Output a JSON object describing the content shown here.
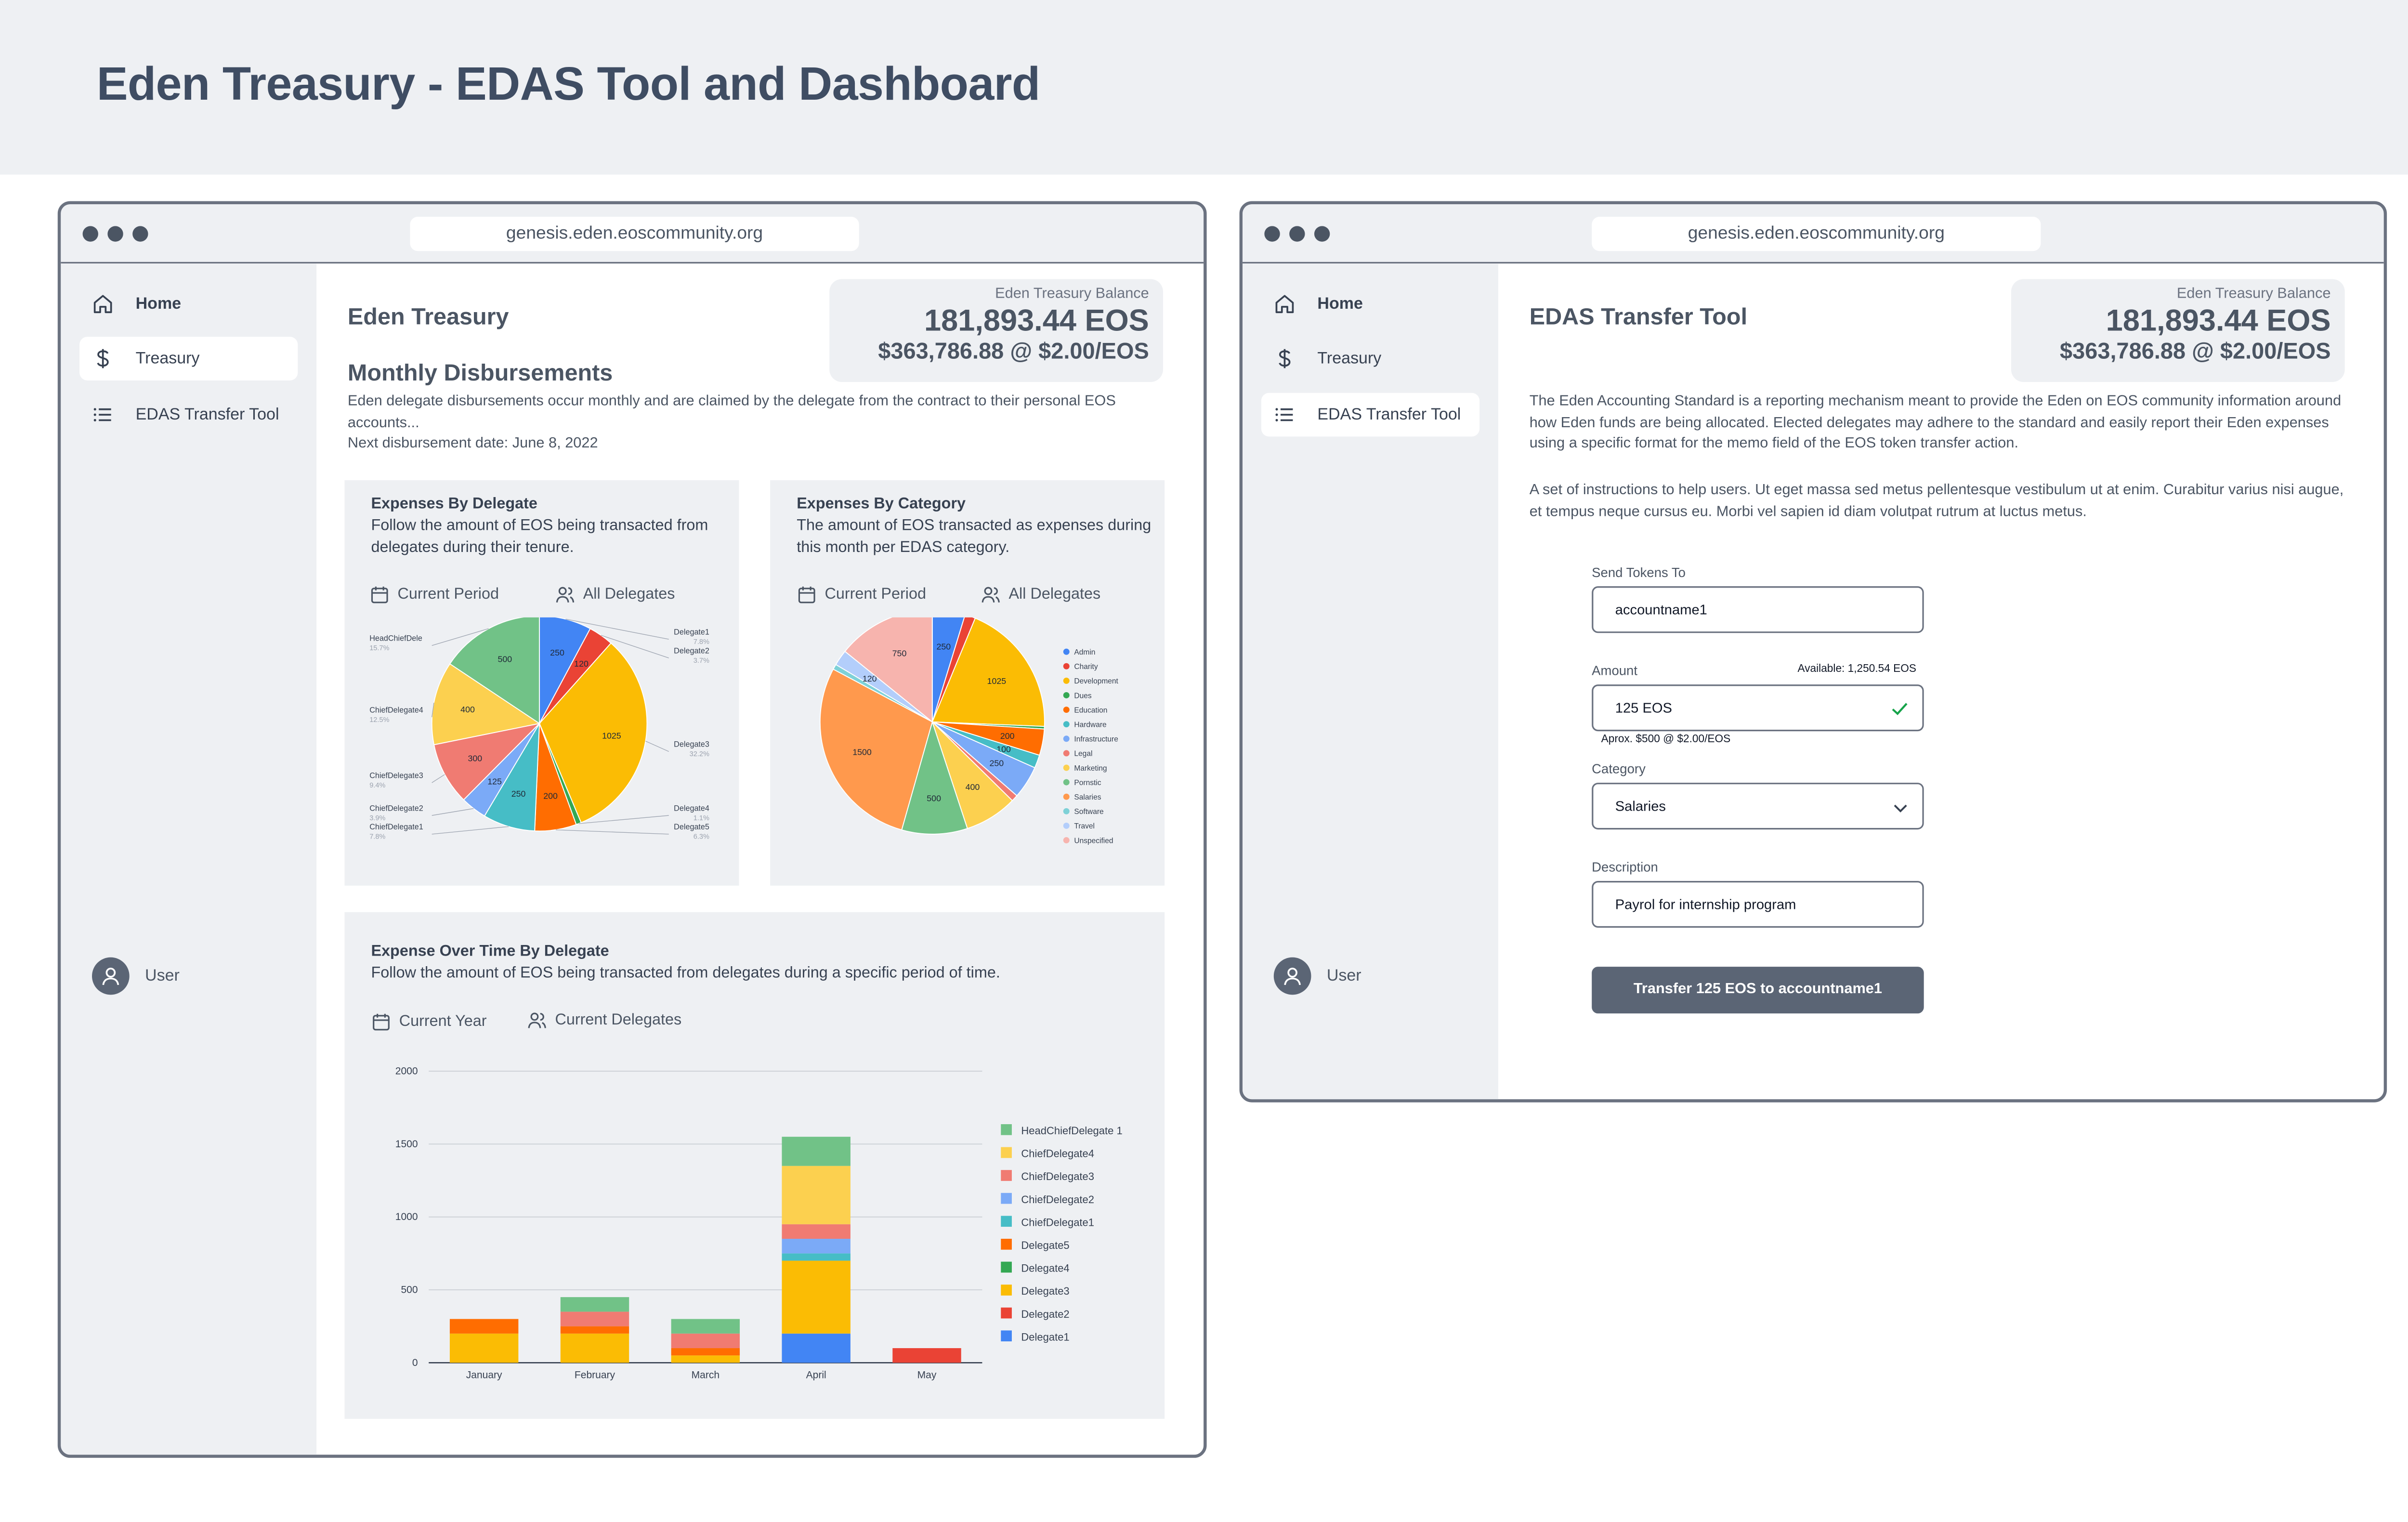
{
  "page_title": "Eden Treasury - EDAS Tool and Dashboard",
  "browser": {
    "url": "genesis.eden.eoscommunity.org"
  },
  "sidebar": {
    "items": [
      {
        "label": "Home",
        "icon": "home-icon"
      },
      {
        "label": "Treasury",
        "icon": "dollar-icon"
      },
      {
        "label": "EDAS Transfer Tool",
        "icon": "list-icon"
      }
    ],
    "user_label": "User"
  },
  "balance": {
    "label": "Eden Treasury Balance",
    "eos": "181,893.44 EOS",
    "usd": "$363,786.88 @ $2.00/EOS"
  },
  "dashboard": {
    "heading": "Eden Treasury",
    "subheading": "Monthly Disbursements",
    "description": "Eden delegate disbursements occur monthly and are claimed by the delegate from the contract to their personal EOS accounts...",
    "next_date": "Next disbursement date: June 8, 2022",
    "card_delegate": {
      "title": "Expenses By Delegate",
      "subtitle": "Follow the amount of EOS being transacted from delegates during their tenure.",
      "filter_period": "Current Period",
      "filter_people": "All Delegates"
    },
    "card_category": {
      "title": "Expenses By Category",
      "subtitle": "The amount of EOS transacted as expenses during this month per EDAS category.",
      "filter_period": "Current Period",
      "filter_people": "All Delegates"
    },
    "card_time": {
      "title": "Expense Over Time By Delegate",
      "subtitle": "Follow the amount of EOS being transacted from delegates during a specific period of time.",
      "filter_period": "Current Year",
      "filter_people": "Current Delegates"
    }
  },
  "transfer": {
    "heading": "EDAS Transfer Tool",
    "desc1": "The Eden Accounting Standard is a reporting mechanism meant to provide the Eden on EOS community information around how Eden funds are being allocated. Elected delegates may adhere to the standard and easily report their Eden expenses using a specific format for the memo field of the EOS token transfer action.",
    "desc2": "A set of instructions to help users. Ut eget massa sed metus pellentesque vestibulum ut at enim. Curabitur varius nisi augue, et tempus neque cursus eu. Morbi vel sapien id diam volutpat rutrum at luctus metus.",
    "send_label": "Send Tokens To",
    "send_value": "accountname1",
    "amount_label": "Amount",
    "available": "Available: 1,250.54 EOS",
    "amount_value": "125 EOS",
    "approx": "Aprox. $500 @ $2.00/EOS",
    "category_label": "Category",
    "category_value": "Salaries",
    "description_label": "Description",
    "description_value": "Payrol for internship program",
    "button": "Transfer 125 EOS to accountname1"
  },
  "chart_data": [
    {
      "type": "pie",
      "title": "Expenses By Delegate",
      "labels": [
        "Delegate1",
        "Delegate2",
        "Delegate3",
        "Delegate4",
        "Delegate5",
        "ChiefDelegate1",
        "ChiefDelegate2",
        "ChiefDelegate3",
        "ChiefDelegate4",
        "HeadChiefDele"
      ],
      "values": [
        250,
        120,
        1025,
        25,
        200,
        250,
        125,
        300,
        400,
        500
      ],
      "percent_labels": [
        "7.8%",
        "3.7%",
        "32.2%",
        "1.1%",
        "6.3%",
        "7.8%",
        "3.9%",
        "9.4%",
        "12.5%",
        "15.7%"
      ],
      "colors": [
        "#4285f4",
        "#ea4335",
        "#fbbc04",
        "#34a853",
        "#ff6d01",
        "#46bdc6",
        "#7baaf7",
        "#f07b72",
        "#fcd04f",
        "#71c287"
      ]
    },
    {
      "type": "pie",
      "title": "Expenses By Category",
      "labels": [
        "Admin",
        "Charity",
        "Development",
        "Dues",
        "Education",
        "Hardware",
        "Infrastructure",
        "Legal",
        "Marketing",
        "Porn",
        "Salaries",
        "Software",
        "Travel",
        "Unspecified"
      ],
      "label_texts": [
        "Admin",
        "Charity",
        "Development",
        "Dues",
        "Education",
        "Hardware",
        "Infrastructure",
        "Legal",
        "Marketing",
        "Pornstic",
        "Salaries",
        "Software",
        "Travel",
        "Unspecified"
      ],
      "values": [
        250,
        80,
        1025,
        20,
        200,
        100,
        250,
        50,
        400,
        500,
        1500,
        40,
        120,
        750
      ],
      "colors": [
        "#4285f4",
        "#ea4335",
        "#fbbc04",
        "#34a853",
        "#ff6d01",
        "#46bdc6",
        "#7baaf7",
        "#f07b72",
        "#fcd04f",
        "#71c287",
        "#ff994d",
        "#7ed1d7",
        "#b3cefb",
        "#f7b4ae"
      ]
    },
    {
      "type": "bar",
      "stacked": true,
      "title": "Expense Over Time By Delegate",
      "categories": [
        "January",
        "February",
        "March",
        "April",
        "May"
      ],
      "ylim": [
        0,
        2000
      ],
      "yticks": [
        0,
        500,
        1000,
        1500,
        2000
      ],
      "series": [
        {
          "name": "Delegate1",
          "color": "#4285f4",
          "values": [
            0,
            0,
            0,
            200,
            0
          ]
        },
        {
          "name": "Delegate2",
          "color": "#ea4335",
          "values": [
            0,
            0,
            0,
            0,
            100
          ]
        },
        {
          "name": "Delegate3",
          "color": "#fbbc04",
          "values": [
            200,
            200,
            50,
            500,
            0
          ]
        },
        {
          "name": "Delegate4",
          "color": "#34a853",
          "values": [
            0,
            0,
            0,
            0,
            0
          ]
        },
        {
          "name": "Delegate5",
          "color": "#ff6d01",
          "values": [
            100,
            50,
            50,
            0,
            0
          ]
        },
        {
          "name": "ChiefDelegate1",
          "color": "#46bdc6",
          "values": [
            0,
            0,
            0,
            50,
            0
          ]
        },
        {
          "name": "ChiefDelegate2",
          "color": "#7baaf7",
          "values": [
            0,
            0,
            0,
            100,
            0
          ]
        },
        {
          "name": "ChiefDelegate3",
          "color": "#f07b72",
          "values": [
            0,
            100,
            100,
            100,
            0
          ]
        },
        {
          "name": "ChiefDelegate4",
          "color": "#fcd04f",
          "values": [
            0,
            0,
            0,
            400,
            0
          ]
        },
        {
          "name": "HeadChiefDelegate 1",
          "color": "#71c287",
          "values": [
            0,
            100,
            100,
            200,
            0
          ]
        }
      ]
    }
  ]
}
